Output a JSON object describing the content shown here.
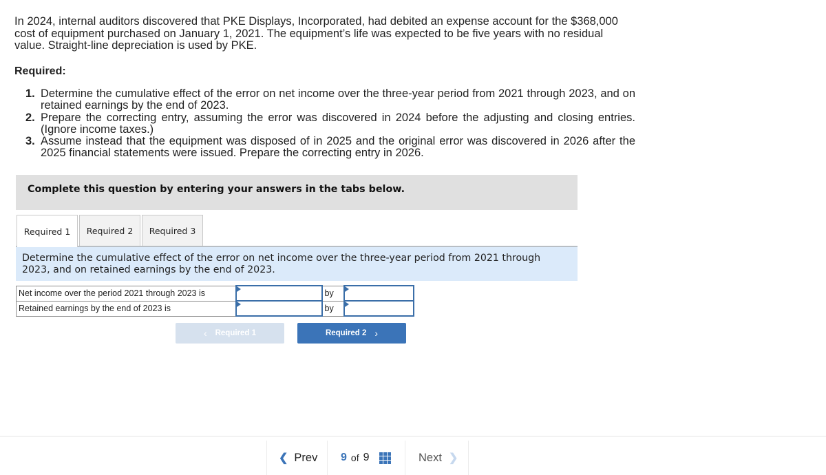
{
  "problem": {
    "intro": "In 2024, internal auditors discovered that PKE Displays, Incorporated, had debited an expense account for the $368,000 cost of equipment purchased on January 1, 2021. The equipment’s life was expected to be five years with no residual value. Straight-line depreciation is used by PKE.",
    "required_heading": "Required:",
    "requirements": [
      {
        "num": "1.",
        "text": "Determine the cumulative effect of the error on net income over the three-year period from 2021 through 2023, and on retained earnings by the end of 2023."
      },
      {
        "num": "2.",
        "text": "Prepare the correcting entry, assuming the error was discovered in 2024 before the adjusting and closing entries. (Ignore income taxes.)"
      },
      {
        "num": "3.",
        "text": "Assume instead that the equipment was disposed of in 2025 and the original error was discovered in 2026 after the 2025 financial statements were issued. Prepare the correcting entry in 2026."
      }
    ]
  },
  "instruction": "Complete this question by entering your answers in the tabs below.",
  "tabs": [
    {
      "label": "Required 1",
      "active": true
    },
    {
      "label": "Required 2",
      "active": false
    },
    {
      "label": "Required 3",
      "active": false
    }
  ],
  "prompt": "Determine the cumulative effect of the error on net income over the three-year period from 2021 through 2023, and on retained earnings by the end of 2023.",
  "answer_rows": [
    {
      "label": "Net income over the period 2021 through 2023 is",
      "value1": "",
      "by": "by",
      "value2": ""
    },
    {
      "label": "Retained earnings by the end of 2023 is",
      "value1": "",
      "by": "by",
      "value2": ""
    }
  ],
  "buttons": {
    "prev_label": "Required 1",
    "next_label": "Required 2"
  },
  "pager": {
    "prev_label": "Prev",
    "current": "9",
    "of_label": "of",
    "total": "9",
    "next_label": "Next"
  },
  "colors": {
    "accent": "#3b74b8",
    "prompt_bg": "#dbeafa",
    "instruction_bg": "#e0e0e0",
    "disabled_button": "#d6e1ee"
  }
}
